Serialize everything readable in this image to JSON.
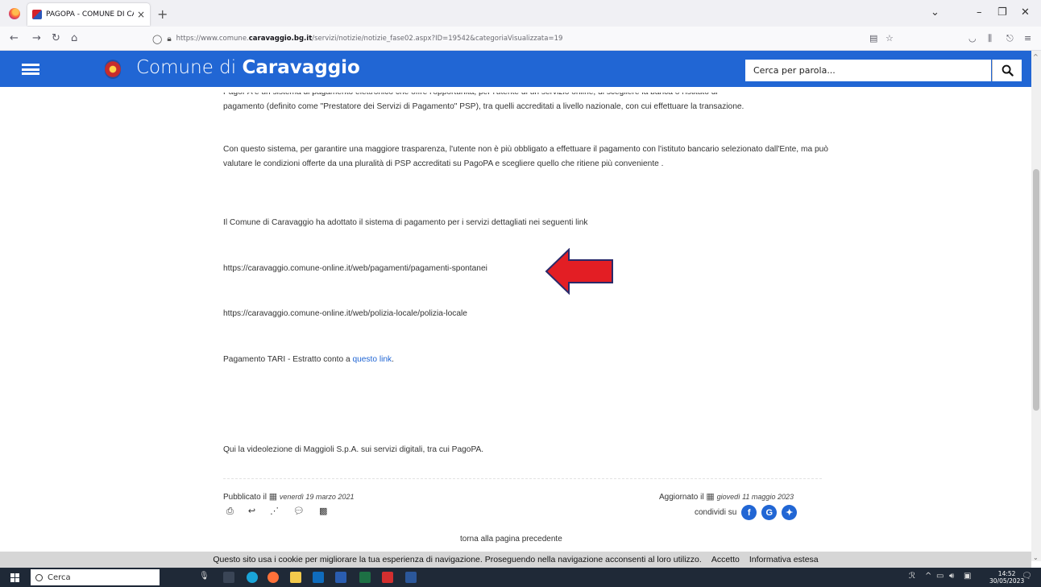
{
  "browser": {
    "tab_title": "PAGOPA - COMUNE DI CARAVAGGIO",
    "tab_close": "×",
    "new_tab": "+",
    "url_prefix": "https://www.comune.",
    "url_domain": "caravaggio.bg.it",
    "url_path": "/servizi/notizie/notizie_fase02.aspx?ID=19542&categoriaVisualizzata=19"
  },
  "header": {
    "title_prefix": "Comune di ",
    "title_bold": "Caravaggio",
    "search_placeholder": "Cerca per parola..."
  },
  "content": {
    "p1_cut": "PagoPA è un sistema di pagamento elettronico che offre l'opportunità, per l'utente di un servizio online, di scegliere la banca o l'istituto di",
    "p1_line2": "pagamento (definito come \"Prestatore dei Servizi di Pagamento\" PSP), tra quelli accreditati a livello nazionale, con cui effettuare la transazione.",
    "p2": "Con questo sistema, per garantire una maggiore trasparenza, l'utente non è più obbligato a effettuare il pagamento con l'istituto bancario selezionato dall'Ente, ma può valutare le condizioni offerte da una pluralità di PSP accreditati su PagoPA e scegliere quello che ritiene più conveniente .",
    "p3": "Il Comune di Caravaggio ha adottato il sistema di pagamento per i servizi dettagliati nei seguenti link",
    "link1": "https://caravaggio.comune-online.it/web/pagamenti/pagamenti-spontanei",
    "link2": "https://caravaggio.comune-online.it/web/polizia-locale/polizia-locale",
    "tari_text": "Pagamento TARI - Estratto conto a ",
    "tari_link": "questo link",
    "tari_end": ".",
    "video": "Qui la videolezione di Maggioli S.p.A. sui servizi digitali, tra cui PagoPA."
  },
  "footer": {
    "published_label": "Pubblicato il",
    "published_date": "venerdì 19 marzo 2021",
    "updated_label": "Aggiornato il",
    "updated_date": "giovedì 11 maggio 2023",
    "share_label": "condividi su",
    "back_link": "torna alla pagina precedente"
  },
  "cookie": {
    "text": "Questo sito usa i cookie per migliorare la tua esperienza di navigazione. Proseguendo nella navigazione acconsenti al loro utilizzo.",
    "accept": "Accetto",
    "info": "Informativa estesa"
  },
  "taskbar": {
    "search": "Cerca",
    "time": "14:52",
    "date": "30/05/2023"
  },
  "colors": {
    "brand_blue": "#2166d4",
    "arrow_red": "#e31e24"
  }
}
